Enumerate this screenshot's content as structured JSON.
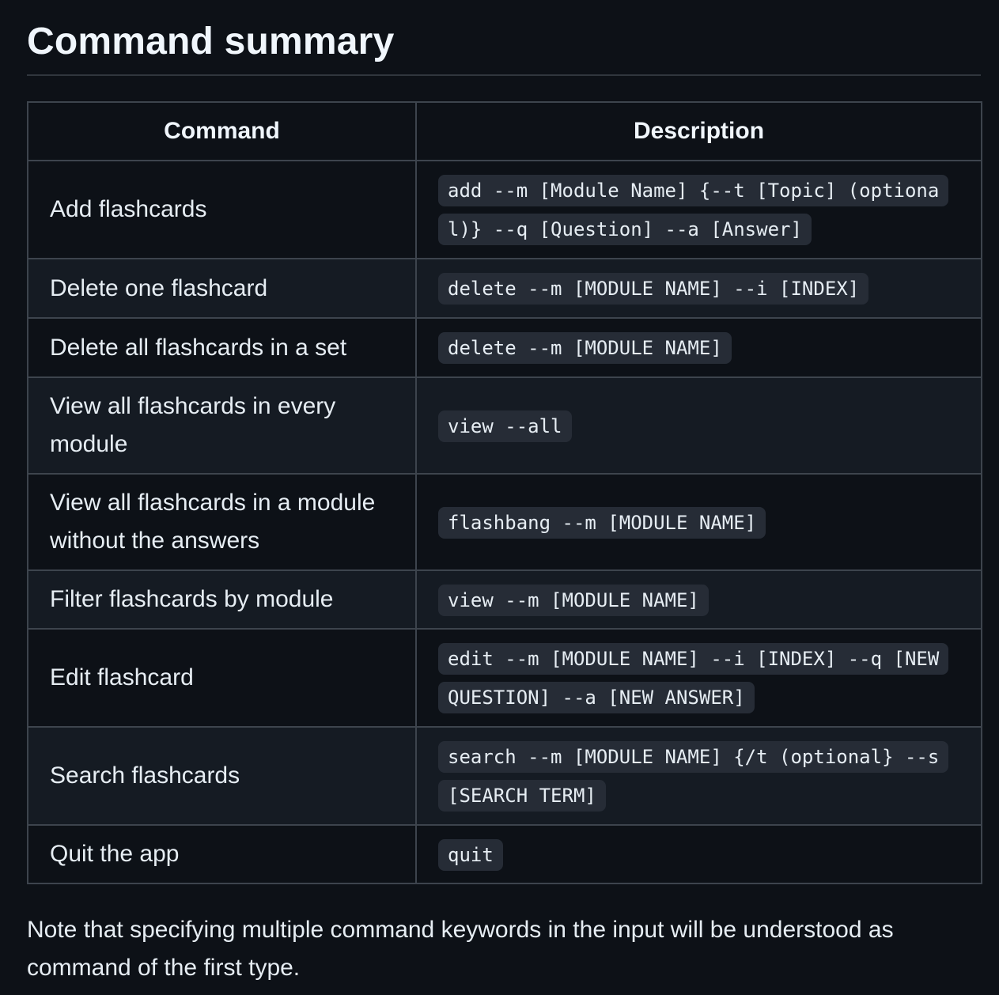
{
  "section": {
    "title": "Command summary"
  },
  "table": {
    "headers": {
      "command": "Command",
      "description": "Description"
    },
    "rows": [
      {
        "command": "Add flashcards",
        "description": "add --m [Module Name] {--t [Topic] (optional)} --q [Question] --a [Answer]"
      },
      {
        "command": "Delete one flashcard",
        "description": "delete --m [MODULE NAME] --i [INDEX]"
      },
      {
        "command": "Delete all flashcards in a set",
        "description": "delete --m [MODULE NAME]"
      },
      {
        "command": "View all flashcards in every module",
        "description": "view --all"
      },
      {
        "command": "View all flashcards in a module without the answers",
        "description": "flashbang --m [MODULE NAME]"
      },
      {
        "command": "Filter flashcards by module",
        "description": "view --m [MODULE NAME]"
      },
      {
        "command": "Edit flashcard",
        "description": "edit --m [MODULE NAME] --i [INDEX] --q [NEW QUESTION] --a [NEW ANSWER]"
      },
      {
        "command": "Search flashcards",
        "description": "search --m [MODULE NAME] {/t (optional} --s [SEARCH TERM]"
      },
      {
        "command": "Quit the app",
        "description": "quit"
      }
    ]
  },
  "note": "Note that specifying multiple command keywords in the input will be understood as command of the first type."
}
